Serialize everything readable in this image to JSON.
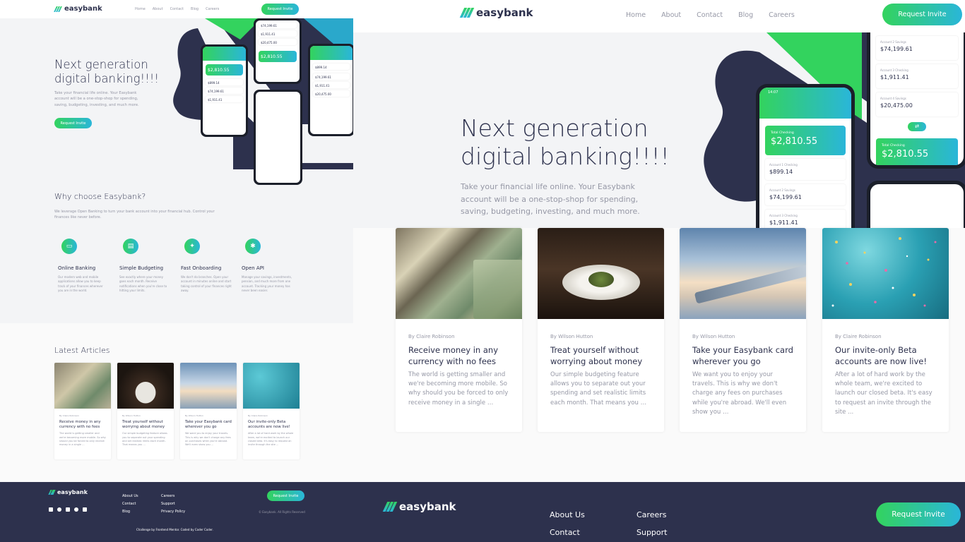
{
  "brand": {
    "name": "easybank"
  },
  "nav": {
    "links": [
      "Home",
      "About",
      "Contact",
      "Blog",
      "Careers"
    ],
    "cta": "Request Invite"
  },
  "hero": {
    "title_line1": "Next generation",
    "title_line2": "digital banking!!!!",
    "text": "Take your financial life online. Your Easybank account will be a one-stop-shop for spending, saving, budgeting, investing, and much more.",
    "cta": "Request Invite"
  },
  "phones": {
    "total_checking_label": "Total Checking",
    "total_checking": "$2,810.55",
    "rows": [
      {
        "label": "Account 1 Checking",
        "value": "$899.14"
      },
      {
        "label": "Account 2 Savings",
        "value": "$74,199.61"
      },
      {
        "label": "Account 3 Checking",
        "value": "$1,911.41"
      },
      {
        "label": "Account 4 Savings",
        "value": "$20,475.00"
      }
    ],
    "time": "14:07"
  },
  "why": {
    "title": "Why choose Easybank?",
    "intro": "We leverage Open Banking to turn your bank account into your financial hub. Control your finances like never before.",
    "features": [
      {
        "icon": "online-banking-icon",
        "title": "Online Banking",
        "text": "Our modern web and mobile applications allow you to keep track of your finances wherever you are in the world."
      },
      {
        "icon": "budgeting-icon",
        "title": "Simple Budgeting",
        "text": "See exactly where your money goes each month. Receive notifications when you're close to hitting your limits."
      },
      {
        "icon": "onboarding-icon",
        "title": "Fast Onboarding",
        "text": "We don't do branches. Open your account in minutes online and start taking control of your finances right away."
      },
      {
        "icon": "api-icon",
        "title": "Open API",
        "text": "Manage your savings, investments, pension, and much more from one account. Tracking your money has never been easier."
      }
    ]
  },
  "latest": {
    "title": "Latest Articles",
    "articles": [
      {
        "author": "By Claire Robinson",
        "title": "Receive money in any currency with no fees",
        "excerpt": "The world is getting smaller and we're becoming more mobile. So why should you be forced to only receive money in a single …",
        "image": "currency-notes-image"
      },
      {
        "author": "By Wilson Hutton",
        "title": "Treat yourself without worrying about money",
        "excerpt": "Our simple budgeting feature allows you to separate out your spending and set realistic limits each month. That means you …",
        "image": "restaurant-plate-image"
      },
      {
        "author": "By Wilson Hutton",
        "title": "Take your Easybank card wherever you go",
        "excerpt": "We want you to enjoy your travels. This is why we don't charge any fees on purchases while you're abroad. We'll even show you …",
        "image": "airplane-wing-image"
      },
      {
        "author": "By Claire Robinson",
        "title": "Our invite-only Beta accounts are now live!",
        "excerpt": "After a lot of hard work by the whole team, we're excited to launch our closed beta. It's easy to request an invite through the site ...",
        "image": "confetti-image"
      }
    ]
  },
  "footer": {
    "col1": [
      "About Us",
      "Contact",
      "Blog"
    ],
    "col2": [
      "Careers",
      "Support",
      "Privacy Policy"
    ],
    "cta": "Request Invite",
    "copyright": "© Easybank. All Rights Reserved",
    "credit": "Challenge by Frontend Mentor. Coded by Coder Coder.",
    "social": [
      "facebook-icon",
      "youtube-icon",
      "twitter-icon",
      "pinterest-icon",
      "instagram-icon"
    ]
  },
  "colors": {
    "dark_blue": "#2d314d",
    "lime_green": "#31d35c",
    "bright_cyan": "#2bb7da",
    "grayish_blue": "#9698a6",
    "light_gray": "#f3f4f6"
  }
}
